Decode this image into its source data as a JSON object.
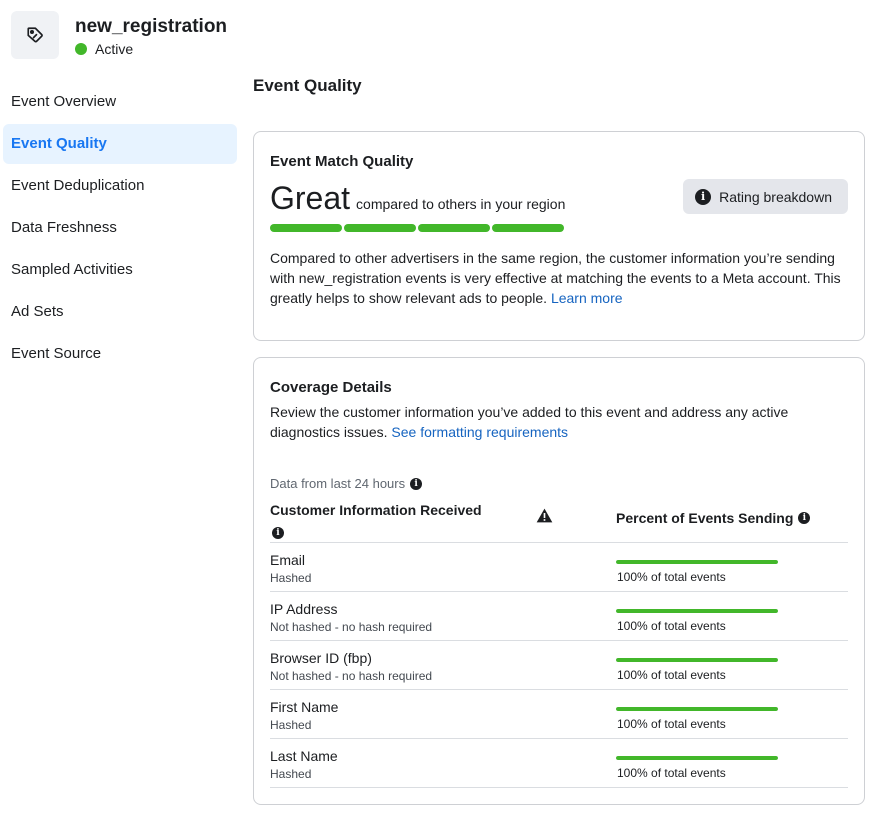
{
  "header": {
    "icon": "tag-icon",
    "title": "new_registration",
    "status": "Active",
    "status_color": "#42b72a"
  },
  "sidebar": {
    "items": [
      {
        "label": "Event Overview",
        "active": false
      },
      {
        "label": "Event Quality",
        "active": true
      },
      {
        "label": "Event Deduplication",
        "active": false
      },
      {
        "label": "Data Freshness",
        "active": false
      },
      {
        "label": "Sampled Activities",
        "active": false
      },
      {
        "label": "Ad Sets",
        "active": false
      },
      {
        "label": "Event Source",
        "active": false
      }
    ]
  },
  "main": {
    "title": "Event Quality",
    "emq": {
      "title": "Event Match Quality",
      "rating": "Great",
      "rating_sub": "compared to others in your region",
      "rating_segments": 4,
      "rating_filled": 4,
      "rating_color": "#42b72a",
      "breakdown_button": "Rating breakdown",
      "description": "Compared to other advertisers in the same region, the customer information you’re sending with new_registration events is very effective at matching the events to a Meta account. This greatly helps to show relevant ads to people.",
      "learn_more": "Learn more"
    },
    "coverage": {
      "title": "Coverage Details",
      "description": "Review the customer information you’ve added to this event and address any active diagnostics issues.",
      "formatting_link": "See formatting requirements",
      "data_note": "Data from last 24 hours",
      "col_left": "Customer Information Received",
      "col_right": "Percent of Events Sending",
      "rows": [
        {
          "name": "Email",
          "sub": "Hashed",
          "percent": 100,
          "pct_label": "100% of total events"
        },
        {
          "name": "IP Address",
          "sub": "Not hashed - no hash required",
          "percent": 100,
          "pct_label": "100% of total events"
        },
        {
          "name": "Browser ID (fbp)",
          "sub": "Not hashed - no hash required",
          "percent": 100,
          "pct_label": "100% of total events"
        },
        {
          "name": "First Name",
          "sub": "Hashed",
          "percent": 100,
          "pct_label": "100% of total events"
        },
        {
          "name": "Last Name",
          "sub": "Hashed",
          "percent": 100,
          "pct_label": "100% of total events"
        }
      ]
    }
  }
}
